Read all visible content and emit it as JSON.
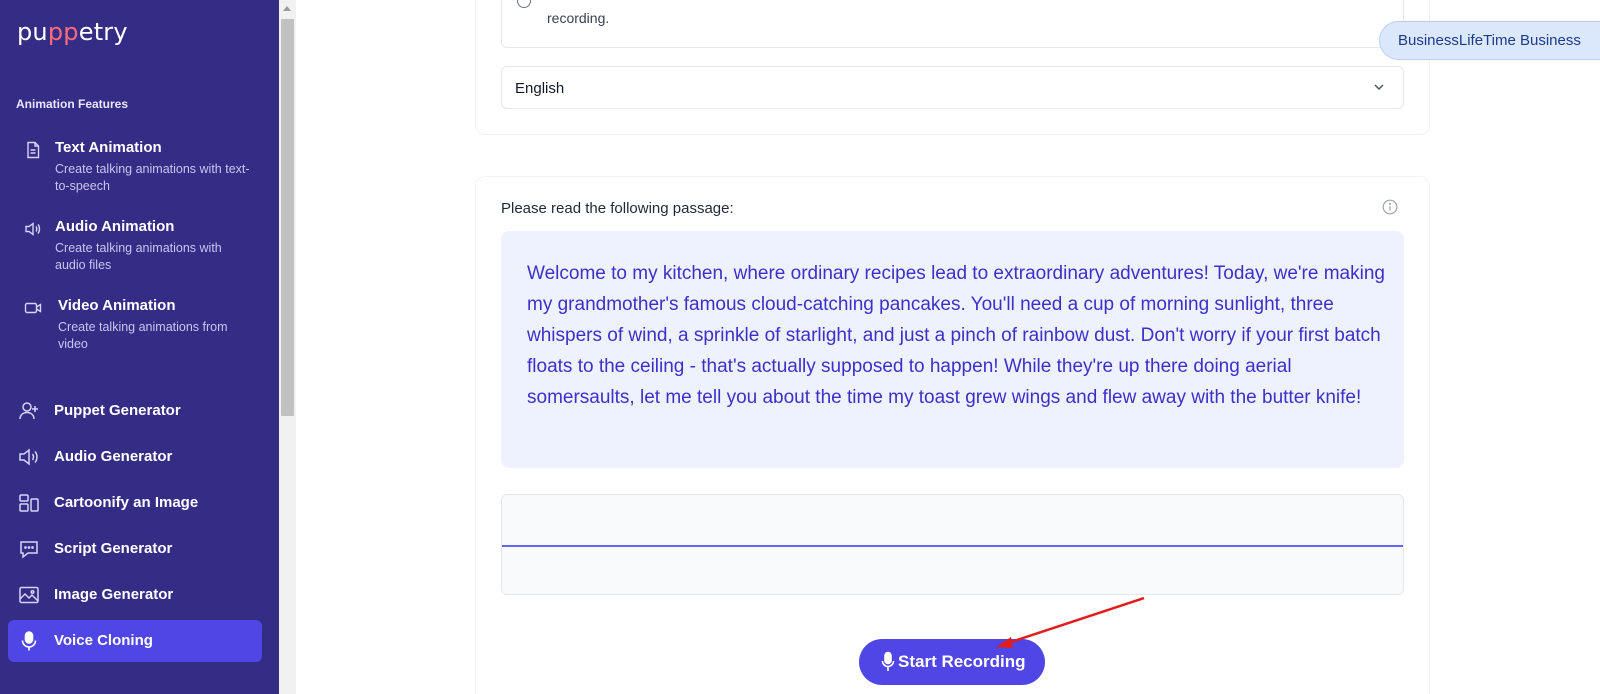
{
  "app": {
    "logo": "puppetry",
    "logo_pp": "pp"
  },
  "sidebar": {
    "section_title": "Animation Features",
    "features": [
      {
        "title": "Text Animation",
        "desc": "Create talking animations with text-to-speech",
        "icon": "document-icon"
      },
      {
        "title": "Audio Animation",
        "desc": "Create talking animations with audio files",
        "icon": "speaker-icon"
      },
      {
        "title": "Video Animation",
        "desc": "Create talking animations from video",
        "icon": "video-camera-icon"
      }
    ],
    "nav": [
      {
        "label": "Puppet Generator",
        "icon": "user-plus-icon"
      },
      {
        "label": "Audio Generator",
        "icon": "speaker-icon"
      },
      {
        "label": "Cartoonify an Image",
        "icon": "layout-icon"
      },
      {
        "label": "Script Generator",
        "icon": "chat-bubble-icon"
      },
      {
        "label": "Image Generator",
        "icon": "image-icon"
      },
      {
        "label": "Voice Cloning",
        "icon": "microphone-icon",
        "active": true
      }
    ]
  },
  "top_card": {
    "notice_text": "recording.",
    "language_select": {
      "value": "English"
    }
  },
  "badge": {
    "label": "BusinessLifeTime Business"
  },
  "main": {
    "passage_label": "Please read the following passage:",
    "passage": "Welcome to my kitchen, where ordinary recipes lead to extraordinary adventures! Today, we're making my grandmother's famous cloud-catching pancakes. You'll need a cup of morning sunlight, three whispers of wind, a sprinkle of starlight, and just a pinch of rainbow dust. Don't worry if your first batch floats to the ceiling - that's actually supposed to happen! While they're up there doing aerial somersaults, let me tell you about the time my toast grew wings and flew away with the butter knife!",
    "record_button": "Start Recording"
  },
  "colors": {
    "sidebar_bg": "#342c85",
    "accent": "#4f46e5",
    "passage_bg": "#eef2ff",
    "passage_text": "#3c30c9",
    "annotation_arrow": "#e11d1d"
  }
}
